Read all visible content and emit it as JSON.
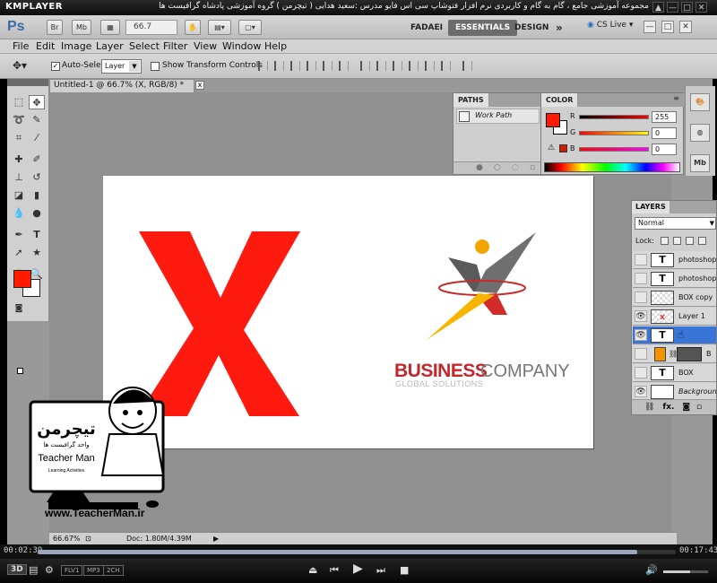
{
  "player": {
    "logo": "KMPLAYER",
    "caption": "مجموعه آموزشی جامع ، گام به گام و کاربردی نرم افزار فتوشاپ سی اس فایو  مدرس :سعید هدایی ( تیچرمن ) گروه آموزشی پادشاه گرافیست ها",
    "window_buttons": [
      "▲",
      "—",
      "□",
      "✕"
    ],
    "time_elapsed": "00:02:39",
    "time_total": "00:17:43",
    "progress_fraction": 0.94,
    "volume_fraction": 0.6,
    "badges": [
      "FLV1",
      "MP3",
      "2CH"
    ],
    "mode_badge": "3D"
  },
  "app": {
    "logo": "Ps",
    "chip_br": "Br",
    "chip_mb": "Mb",
    "zoom": "66.7",
    "workspaces": [
      "FADAEI",
      "ESSENTIALS",
      "DESIGN"
    ],
    "more": "»",
    "cs_live": "CS Live",
    "window_buttons": [
      "—",
      "□",
      "✕"
    ]
  },
  "menu": [
    "File",
    "Edit",
    "Image",
    "Layer",
    "Select",
    "Filter",
    "View",
    "Window",
    "Help"
  ],
  "options": {
    "auto_select_label": "Auto-Select:",
    "auto_select_value": "Layer",
    "show_transform_label": "Show Transform Controls"
  },
  "document": {
    "tab_title": "Untitled-1 @ 66.7% (X, RGB/8) *",
    "close": "x",
    "status_zoom": "66.67%",
    "status_doc": "Doc: 1.80M/4.39M"
  },
  "paths_panel": {
    "tab": "PATHS",
    "item": "Work Path"
  },
  "color_panel": {
    "tab": "COLOR",
    "channels": [
      {
        "label": "R",
        "value": "255"
      },
      {
        "label": "G",
        "value": "0"
      },
      {
        "label": "B",
        "value": "0"
      }
    ],
    "fg_color": "#ff1a00"
  },
  "layers_panel": {
    "tab": "LAYERS",
    "blend_mode": "Normal",
    "lock_label": "Lock:",
    "layers": [
      {
        "name": "photoshop",
        "kind": "text",
        "visible": false
      },
      {
        "name": "photoshop",
        "kind": "text",
        "visible": false
      },
      {
        "name": "BOX copy",
        "kind": "raster",
        "visible": false
      },
      {
        "name": "Layer 1",
        "kind": "raster-x",
        "visible": true
      },
      {
        "name": "",
        "kind": "text",
        "visible": true,
        "selected": true
      },
      {
        "name": "B",
        "kind": "shape",
        "visible": false
      },
      {
        "name": "BOX",
        "kind": "text",
        "visible": false
      },
      {
        "name": "Background",
        "kind": "background",
        "visible": true
      }
    ],
    "footer": "fx."
  },
  "canvas_content": {
    "big_letter": "X",
    "big_letter_color": "#ff1a0f",
    "brand_word_1": "BUSINESS",
    "brand_word_2": "COMPANY",
    "tagline": "GLOBAL SOLUTIONS"
  },
  "watermark": {
    "name_fa": "تیچرمن",
    "subtitle_fa": "واحد گرافیست ها",
    "name_en": "Teacher Man",
    "slogan": "Learning Activities",
    "url": "www.TeacherMan.ir"
  }
}
